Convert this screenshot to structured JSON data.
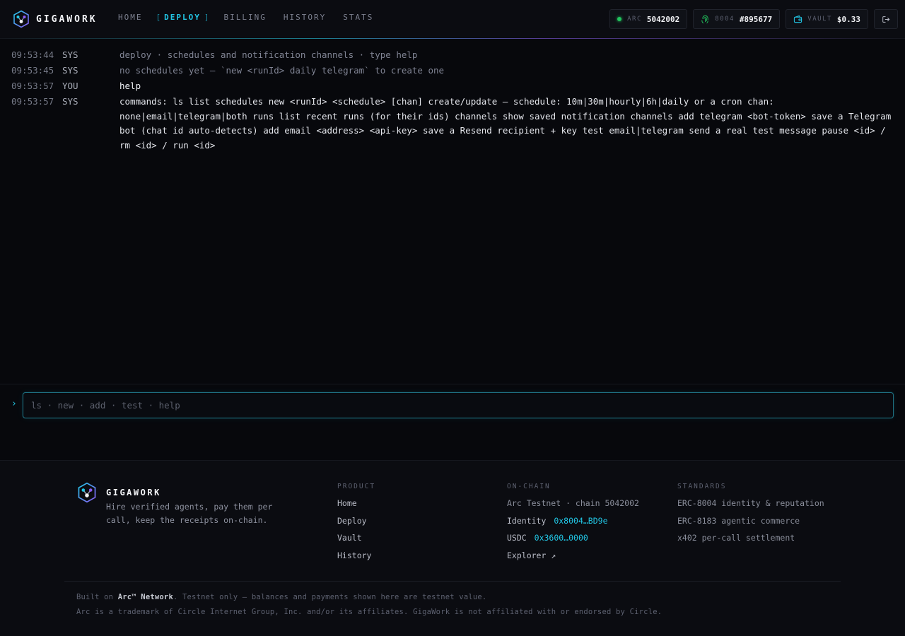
{
  "header": {
    "brand": "GIGAWORK",
    "nav": [
      {
        "label": "HOME"
      },
      {
        "label": "DEPLOY",
        "active": true
      },
      {
        "label": "BILLING"
      },
      {
        "label": "HISTORY"
      },
      {
        "label": "STATS"
      }
    ],
    "chips": {
      "arc": {
        "key": "ARC",
        "value": "5042002",
        "icon": "status-dot"
      },
      "identity": {
        "key": "8004",
        "value": "#895677",
        "icon": "fingerprint-icon"
      },
      "vault": {
        "key": "VAULT",
        "value": "$0.33",
        "icon": "wallet-icon"
      },
      "logout": {
        "icon": "logout-icon"
      }
    }
  },
  "log": [
    {
      "time": "09:53:44",
      "who": "SYS",
      "msg": "deploy · schedules and notification channels · type help"
    },
    {
      "time": "09:53:45",
      "who": "SYS",
      "msg": "no schedules yet — `new <runId> daily telegram` to create one"
    },
    {
      "time": "09:53:57",
      "who": "YOU",
      "msg": "help"
    },
    {
      "time": "09:53:57",
      "who": "SYS",
      "msg": "commands: ls list schedules new <runId> <schedule> [chan] create/update — schedule: 10m|30m|hourly|6h|daily or a cron chan: none|email|telegram|both runs list recent runs (for their ids) channels show saved notification channels add telegram <bot-token> save a Telegram bot (chat id auto-detects) add email <address> <api-key> save a Resend recipient + key test email|telegram send a real test message pause <id> / rm <id> / run <id>"
    }
  ],
  "prompt": {
    "caret": "›",
    "placeholder": "ls · new · add · test · help",
    "value": ""
  },
  "footer": {
    "brand": "GIGAWORK",
    "tagline": "Hire verified agents, pay them per call, keep the receipts on-chain.",
    "product": {
      "title": "PRODUCT",
      "links": [
        "Home",
        "Deploy",
        "Vault",
        "History"
      ]
    },
    "onchain": {
      "title": "ON-CHAIN",
      "network": "Arc Testnet · chain 5042002",
      "identity_label": "Identity",
      "identity_value": "0x8004…BD9e",
      "usdc_label": "USDC",
      "usdc_value": "0x3600…0000",
      "explorer": "Explorer ↗"
    },
    "standards": {
      "title": "STANDARDS",
      "items": [
        "ERC-8004 identity & reputation",
        "ERC-8183 agentic commerce",
        "x402 per-call settlement"
      ]
    },
    "note1_prefix": "Built on ",
    "note1_bold": "Arc™ Network",
    "note1_suffix": ". Testnet only — balances and payments shown here are testnet value.",
    "note2": "Arc is a trademark of Circle Internet Group, Inc. and/or its affiliates. GigaWork is not affiliated with or endorsed by Circle."
  },
  "colors": {
    "accent": "#22c7e6",
    "violet": "#8b5cf6",
    "status_ok": "#22c55e"
  }
}
